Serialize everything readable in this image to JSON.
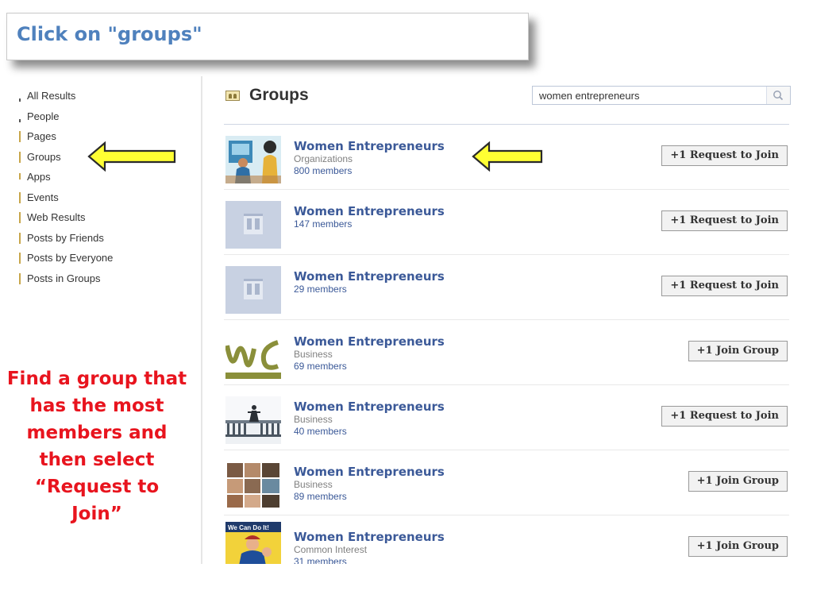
{
  "callout": {
    "text": "Click on \"groups\""
  },
  "sidebar": {
    "items": [
      {
        "label": "All Results"
      },
      {
        "label": "People"
      },
      {
        "label": "Pages"
      },
      {
        "label": "Groups"
      },
      {
        "label": "Apps"
      },
      {
        "label": "Events"
      },
      {
        "label": "Web Results"
      },
      {
        "label": "Posts by Friends"
      },
      {
        "label": "Posts by Everyone"
      },
      {
        "label": "Posts in Groups"
      }
    ]
  },
  "instruction": {
    "text": "Find a group that has the most members and then select “Request to Join”"
  },
  "main": {
    "title": "Groups",
    "search": {
      "value": "women entrepreneurs"
    },
    "results": [
      {
        "name": "Women Entrepreneurs",
        "category": "Organizations",
        "members": "800 members",
        "button": "+1 Request to Join",
        "thumb": "photo-illustration"
      },
      {
        "name": "Women Entrepreneurs",
        "category": "",
        "members": "147 members",
        "button": "+1 Request to Join",
        "thumb": "default-group"
      },
      {
        "name": "Women Entrepreneurs",
        "category": "",
        "members": "29 members",
        "button": "+1 Request to Join",
        "thumb": "default-group"
      },
      {
        "name": "Women Entrepreneurs",
        "category": "Business",
        "members": "69 members",
        "button": "+1 Join Group",
        "thumb": "we-logo"
      },
      {
        "name": "Women Entrepreneurs",
        "category": "Business",
        "members": "40 members",
        "button": "+1 Request to Join",
        "thumb": "pier-photo"
      },
      {
        "name": "Women Entrepreneurs",
        "category": "Business",
        "members": "89 members",
        "button": "+1 Join Group",
        "thumb": "people-collage"
      },
      {
        "name": "Women Entrepreneurs",
        "category": "Common Interest",
        "members": "31 members",
        "button": "+1 Join Group",
        "thumb": "we-can-do-it"
      }
    ]
  },
  "thumb_texts": {
    "we_can_do_it": "We Can Do It!"
  },
  "colors": {
    "accent": "#3b5998",
    "callout_text": "#4f81bd",
    "instruction_red": "#e8141e",
    "arrow_fill": "#ffff33"
  }
}
